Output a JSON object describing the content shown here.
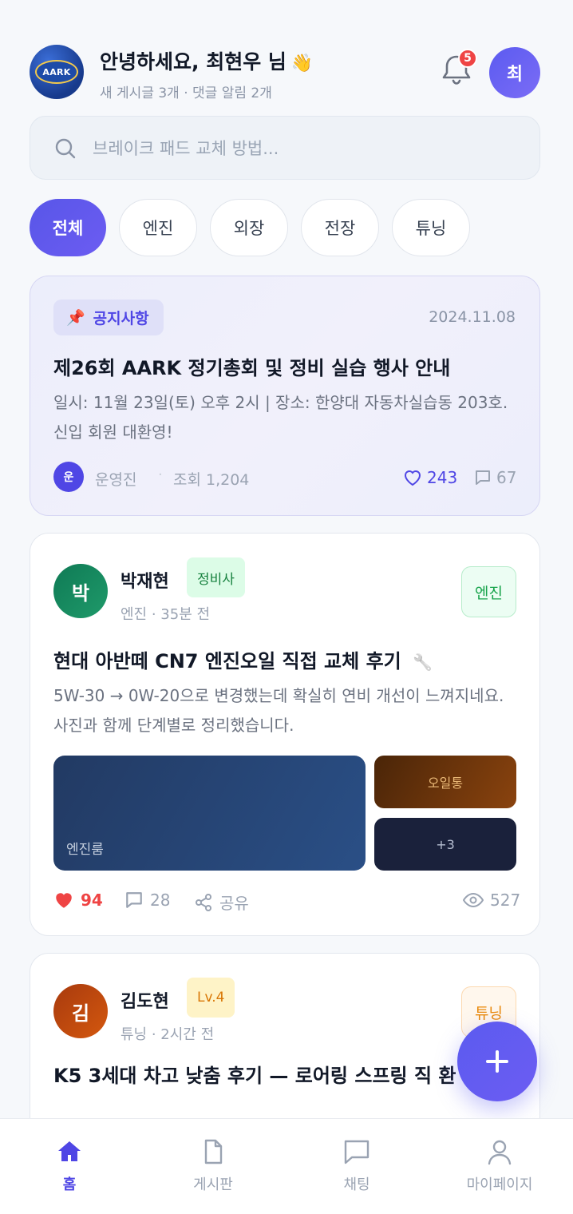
{
  "header": {
    "logo_text": "AARK",
    "greeting": "안녕하세요, 최현우 님",
    "greeting_emoji": "👋",
    "subtitle": "새 게시글 3개 · 댓글 알림 2개",
    "notification_count": "5",
    "user_initial": "최"
  },
  "search": {
    "placeholder": "브레이크 패드 교체 방법..."
  },
  "filters": [
    {
      "label": "전체",
      "active": true
    },
    {
      "label": "엔진",
      "active": false
    },
    {
      "label": "외장",
      "active": false
    },
    {
      "label": "전장",
      "active": false
    },
    {
      "label": "튜닝",
      "active": false
    }
  ],
  "notice": {
    "tag": "공지사항",
    "tag_icon": "📌",
    "date": "2024.11.08",
    "title": "제26회 AARK 정기총회 및 정비 실습 행사 안내",
    "body": "일시: 11월 23일(토) 오후 2시 | 장소: 한양대 자동차실습동 203호. 신입 회원 대환영!",
    "author_initial": "운",
    "author": "운영진",
    "views": "조회 1,204",
    "likes": "243",
    "comments": "67"
  },
  "posts": [
    {
      "initial": "박",
      "author": "박재현",
      "role": "정비사",
      "meta": "엔진 · 35분 전",
      "category": "엔진",
      "title": "현대 아반떼 CN7 엔진오일 직접 교체 후기",
      "title_emoji": "🔧",
      "body": "5W-30 → 0W-20으로 변경했는데 확실히 연비 개선이 느껴지네요. 사진과 함께 단계별로 정리했습니다.",
      "images": {
        "main": "엔진룸",
        "side1": "오일통",
        "more": "+3"
      },
      "likes": "94",
      "comments": "28",
      "share": "공유",
      "views": "527"
    },
    {
      "initial": "김",
      "author": "김도현",
      "role": "Lv.4",
      "meta": "튜닝 · 2시간 전",
      "category": "튜닝",
      "title": "K5 3세대 차고 낮춤 후기 — 로어링 스프링 직 환"
    }
  ],
  "fab_icon": "plus-icon",
  "tabbar": [
    {
      "label": "홈",
      "icon": "home-icon",
      "active": true
    },
    {
      "label": "게시판",
      "icon": "document-icon",
      "active": false
    },
    {
      "label": "채팅",
      "icon": "chat-icon",
      "active": false
    },
    {
      "label": "마이페이지",
      "icon": "user-icon",
      "active": false
    }
  ],
  "colors": {
    "accent": "#4f46e5",
    "like_red": "#ef4444",
    "engine_green": "#16a34a",
    "tuning_orange": "#ea8a0c"
  }
}
